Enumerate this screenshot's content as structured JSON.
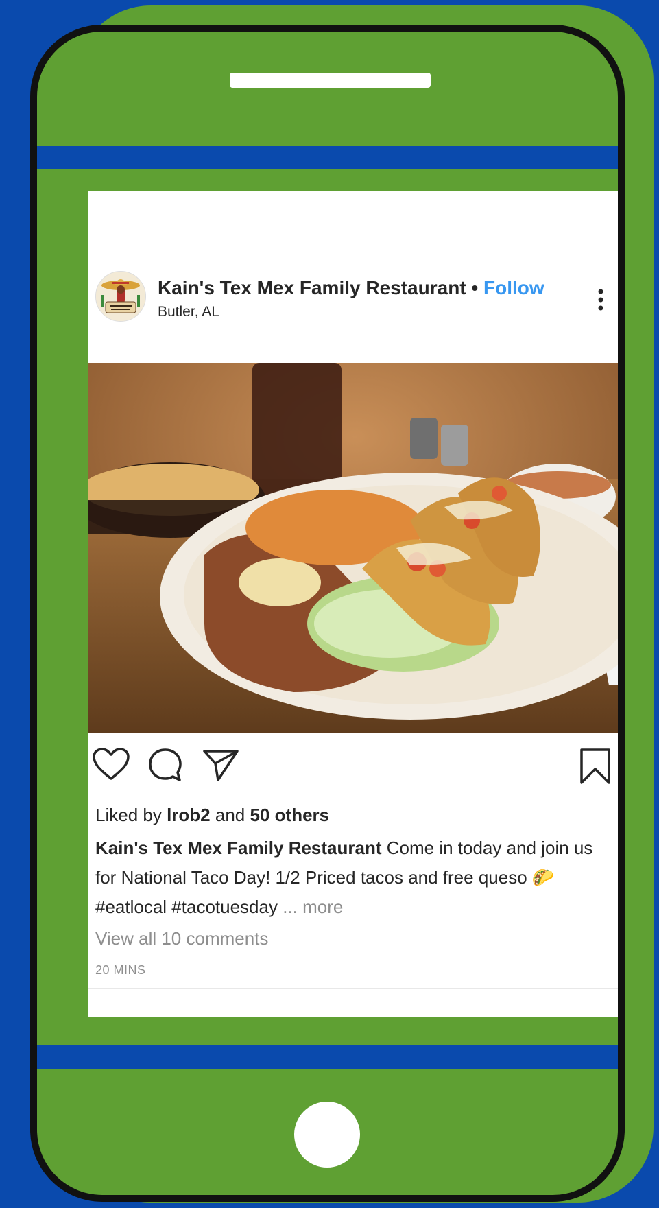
{
  "post": {
    "account_name": "Kain's Tex Mex Family Restaurant",
    "separator": "•",
    "follow_label": "Follow",
    "location": "Butler, AL",
    "avatar_icon": "sombrero-logo-icon",
    "image_alt": "Crispy tacos plate with rice, refried beans and lettuce",
    "likes": {
      "prefix": "Liked by",
      "user": "lrob2",
      "conjunction": "and",
      "others": "50 others"
    },
    "caption": {
      "user": "Kain's Tex Mex Family Restaurant",
      "text": "Come in today and join us for National Taco Day! 1/2 Priced tacos and free queso",
      "emoji": "🌮",
      "hashtags": "#eatlocal #tacotuesday",
      "ellipsis": "...",
      "more_label": "more"
    },
    "comments_link": "View all 10 comments",
    "timestamp": "20 MINS"
  },
  "icons": {
    "like": "heart-icon",
    "comment": "comment-bubble-icon",
    "share": "paper-plane-icon",
    "save": "bookmark-icon",
    "options": "more-vertical-icon"
  },
  "colors": {
    "background_blue": "#0a4aad",
    "phone_green": "#5fa033",
    "follow_blue": "#3897f0"
  }
}
